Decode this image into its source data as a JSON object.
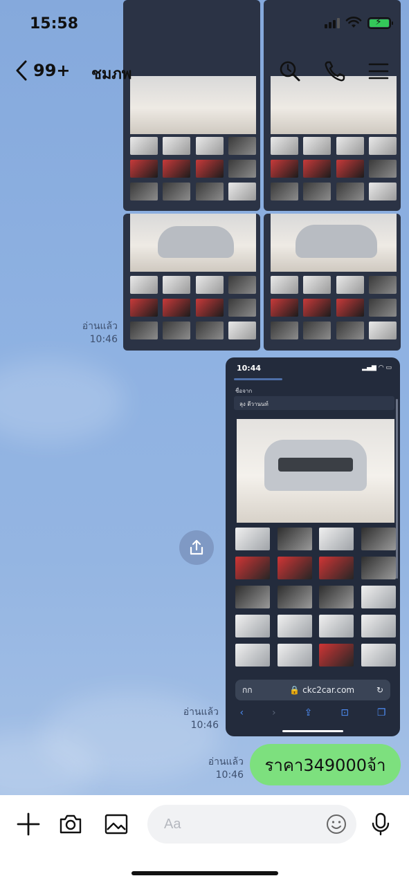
{
  "status_bar": {
    "time": "15:58"
  },
  "header": {
    "back_count": "99+",
    "chat_name": "ชมภพ"
  },
  "messages": {
    "photo_group": {
      "read_label": "อ่านแล้ว",
      "time": "10:46"
    },
    "screenshot": {
      "read_label": "อ่านแล้ว",
      "time": "10:46",
      "inner": {
        "time": "10:44",
        "field_label": "ชื่อจาก",
        "field_value": "ลุง ดีวานนท์",
        "url_aa": "กก",
        "url": "ckc2car.com"
      }
    },
    "text_message": {
      "read_label": "อ่านแล้ว",
      "time": "10:46",
      "text": "ราคา349000จ้า"
    }
  },
  "input_bar": {
    "placeholder": "Aa"
  },
  "colors": {
    "bubble": "#7de07e",
    "background": "#8aaedd",
    "input_bg": "#f1f2f4"
  },
  "icons": [
    "back-chevron-icon",
    "search-icon",
    "phone-icon",
    "menu-icon",
    "share-icon",
    "plus-icon",
    "camera-icon",
    "gallery-icon",
    "emoji-icon",
    "microphone-icon"
  ]
}
